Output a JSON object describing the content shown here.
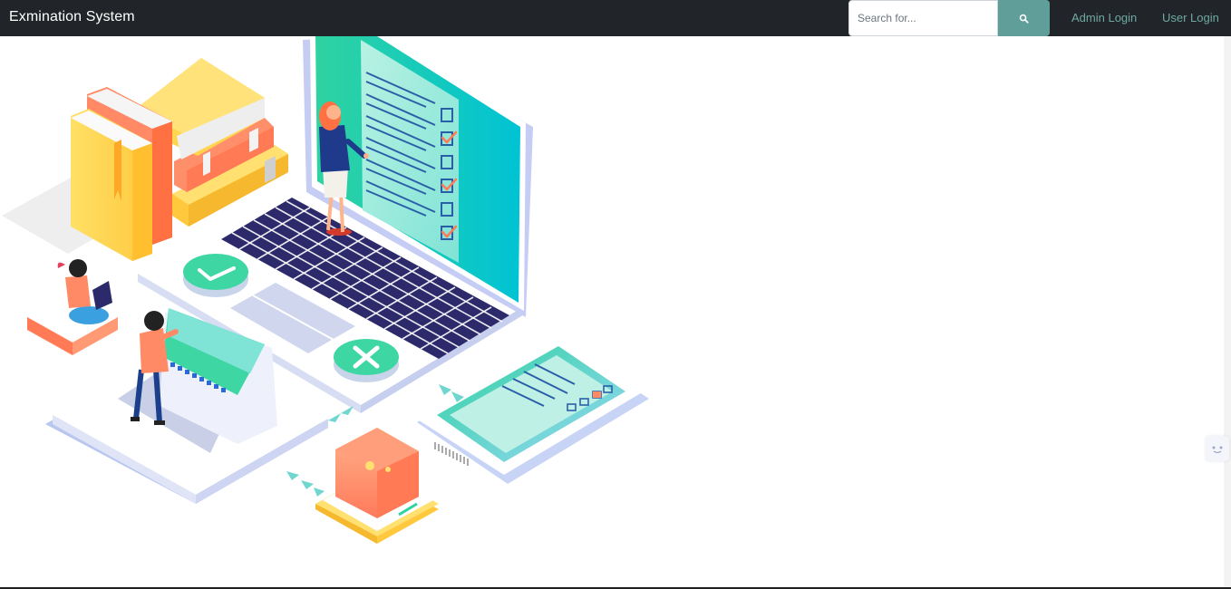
{
  "navbar": {
    "brand": "Exmination System",
    "search": {
      "placeholder": "Search for...",
      "value": "",
      "button_icon": "search-icon"
    },
    "links": {
      "admin_login": "Admin Login",
      "user_login": "User Login"
    }
  },
  "hero": {
    "illustration": "online-exam-isometric-illustration"
  },
  "side_widget": {
    "icon": "widget-face-icon"
  },
  "colors": {
    "navbar_bg": "#212529",
    "accent_teal": "#5f9e99",
    "link_teal": "#6fa9a3",
    "orange": "#ff8a65",
    "yellow": "#ffd54f",
    "navy": "#2c2a6b",
    "green": "#2fd3a0"
  }
}
